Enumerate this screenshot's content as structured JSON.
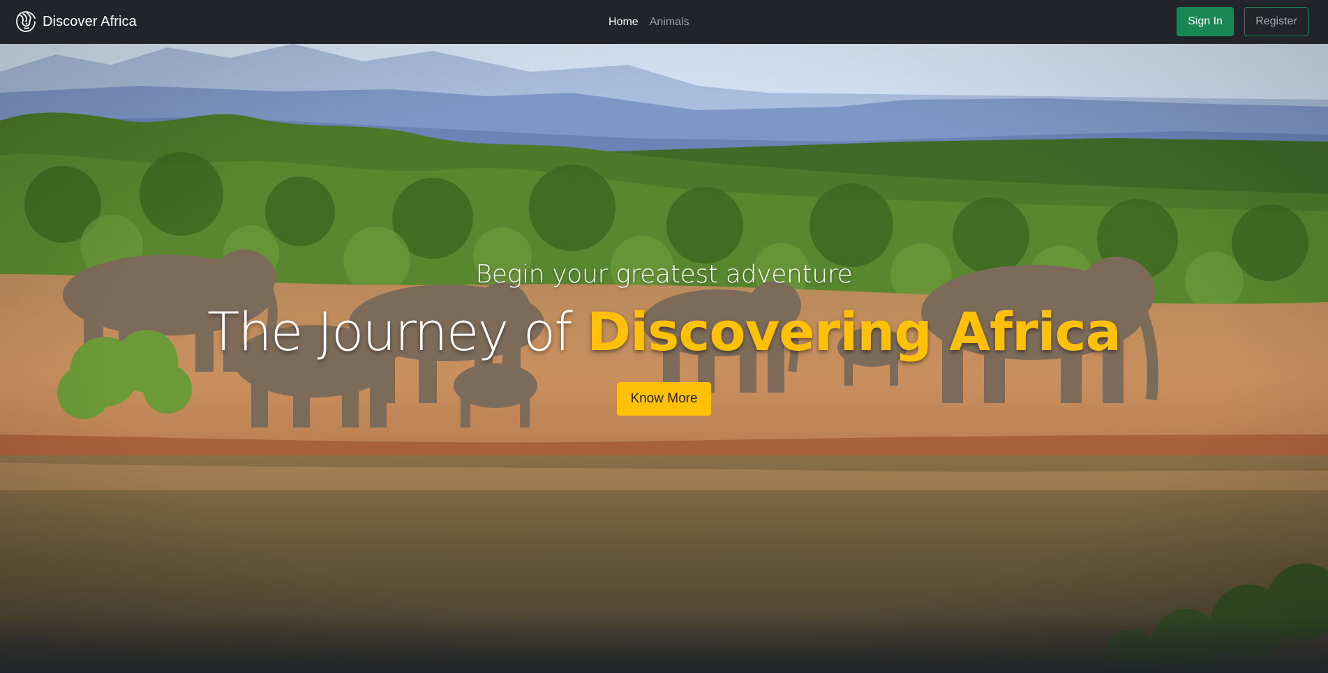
{
  "brand": {
    "name": "Discover Africa",
    "icon": "lion-icon"
  },
  "nav": {
    "links": [
      {
        "label": "Home",
        "active": true
      },
      {
        "label": "Animals",
        "active": false
      }
    ]
  },
  "auth": {
    "sign_in_label": "Sign In",
    "register_label": "Register"
  },
  "hero": {
    "subtitle": "Begin your greatest adventure",
    "title_plain": "The Journey of ",
    "title_accent": "Discovering Africa",
    "cta_label": "Know More",
    "background": "elephant herd walking along a riverbank in the savanna with mountains behind"
  },
  "colors": {
    "navbar_bg": "#212529",
    "success": "#198754",
    "accent": "#ffc107"
  }
}
